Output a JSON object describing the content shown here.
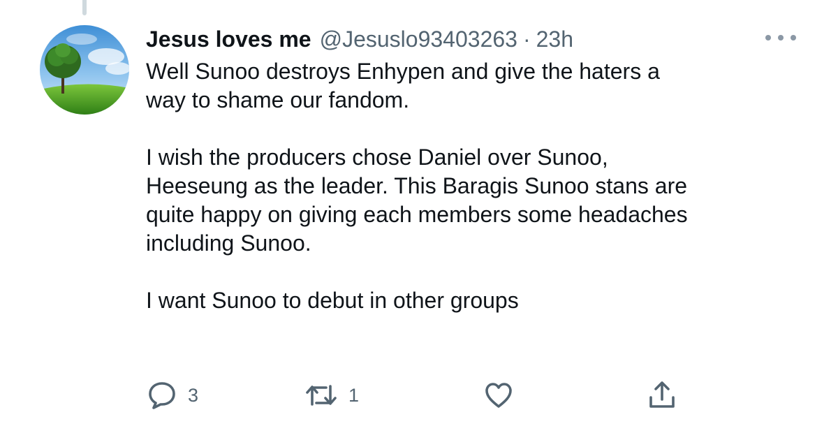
{
  "tweet": {
    "display_name": "Jesus loves me",
    "handle": "@Jesuslo93403263",
    "separator": "·",
    "time": "23h",
    "paragraphs": [
      "Well Sunoo destroys Enhypen and give the haters a\nway to shame our fandom.",
      "I wish the producers chose Daniel over Sunoo,\nHeeseung as the leader. This Baragis Sunoo stans are\nquite happy on giving each members some headaches\nincluding Sunoo.",
      "I want Sunoo to debut in other groups"
    ],
    "actions": {
      "reply": {
        "icon": "reply-icon",
        "count": "3"
      },
      "retweet": {
        "icon": "retweet-icon",
        "count": "1"
      },
      "like": {
        "icon": "heart-icon",
        "count": ""
      },
      "share": {
        "icon": "share-icon"
      }
    },
    "more_icon": "more-dots-icon"
  },
  "colors": {
    "text_primary": "#0f1419",
    "text_secondary": "#536471",
    "thread_line": "#cfd9de"
  }
}
